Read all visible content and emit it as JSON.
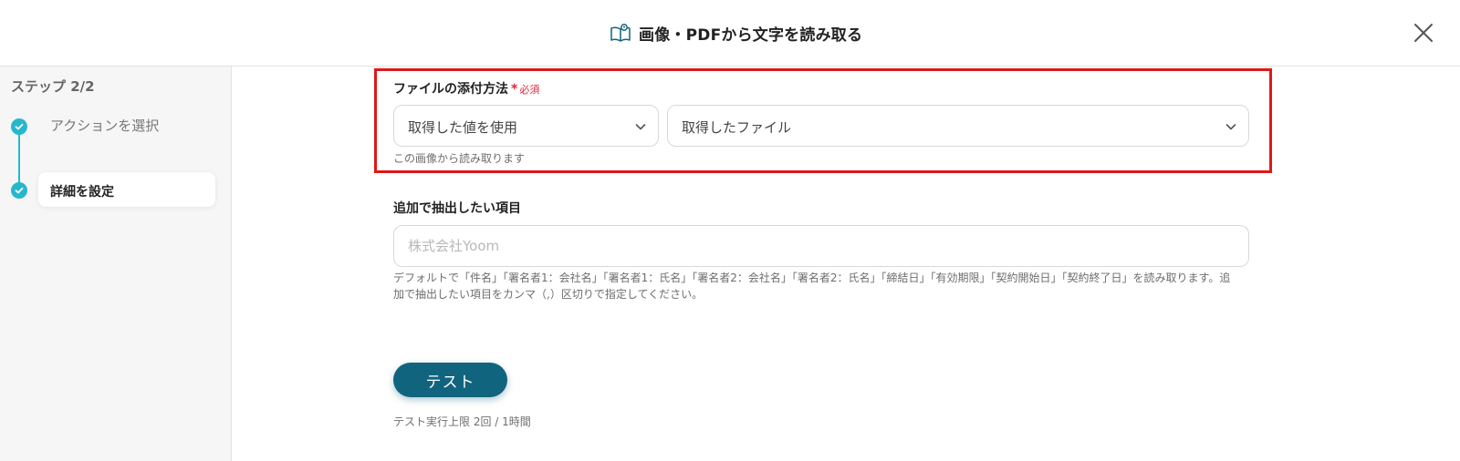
{
  "header": {
    "title": "画像・PDFから文字を読み取る",
    "icon": "book-reader-icon",
    "close_icon": "close-icon"
  },
  "sidebar": {
    "step_title": "ステップ 2/2",
    "steps": [
      {
        "label": "アクションを選択",
        "status": "completed",
        "active": false
      },
      {
        "label": "詳細を設定",
        "status": "completed",
        "active": true
      }
    ],
    "accent_color": "#27b7cc"
  },
  "form": {
    "attach_method": {
      "label": "ファイルの添付方法",
      "required_mark": "*",
      "required_text": "必須",
      "select1_value": "取得した値を使用",
      "select2_value": "取得したファイル",
      "hint": "この画像から読み取ります"
    },
    "extract_items": {
      "label": "追加で抽出したい項目",
      "placeholder": "株式会社Yoom",
      "value": "",
      "hint_line1": "デフォルトで「件名」「署名者1：会社名」「署名者1：氏名」「署名者2：会社名」「署名者2：氏名」「締結日」「有効期限」「契約開始日」「契約終了日」を読み取ります。追",
      "hint_line2": "加で抽出したい項目をカンマ（,）区切りで指定してください。"
    },
    "test_button": "テスト",
    "test_limit": "テスト実行上限 2回 / 1時間"
  },
  "colors": {
    "highlight": "#e01818",
    "required": "#e0263a",
    "button": "#10647e"
  }
}
